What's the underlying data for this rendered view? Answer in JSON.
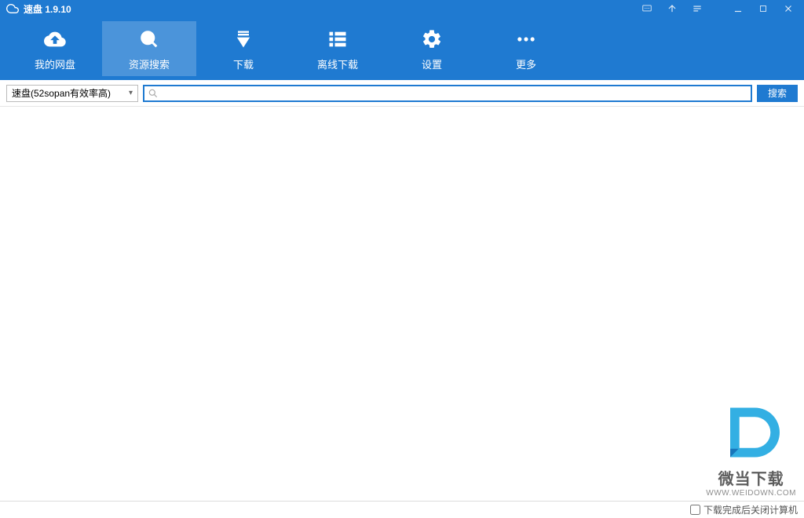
{
  "titlebar": {
    "app_name": "速盘",
    "version": "1.9.10"
  },
  "toolbar": {
    "items": [
      {
        "id": "my-netdisk",
        "label": "我的网盘"
      },
      {
        "id": "resource-search",
        "label": "资源搜索"
      },
      {
        "id": "download",
        "label": "下载"
      },
      {
        "id": "offline-download",
        "label": "离线下载"
      },
      {
        "id": "settings",
        "label": "设置"
      },
      {
        "id": "more",
        "label": "更多"
      }
    ],
    "active_index": 1
  },
  "searchbar": {
    "source_selected": "速盘(52sopan有效率高)",
    "search_value": "",
    "search_placeholder": "",
    "search_button_label": "搜索"
  },
  "statusbar": {
    "shutdown_after_download_label": "下载完成后关闭计算机",
    "shutdown_checked": false
  },
  "watermark": {
    "line1": "微当下载",
    "line2": "WWW.WEIDOWN.COM"
  }
}
